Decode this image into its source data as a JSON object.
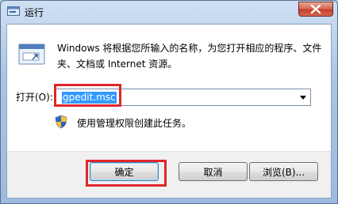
{
  "window": {
    "title": "运行"
  },
  "dialog": {
    "description": "Windows 将根据您所输入的名称，为您打开相应的程序、文件夹、文档或 Internet 资源。",
    "open_label": "打开(O):",
    "input_value": "gpedit.msc",
    "admin_note": "使用管理权限创建此任务。"
  },
  "buttons": {
    "ok": "确定",
    "cancel": "取消",
    "browse": "浏览(B)..."
  },
  "icons": [
    "run-program-icon",
    "close-icon",
    "dropdown-arrow-icon",
    "uac-shield-icon"
  ],
  "colors": {
    "highlight_box": "#e0262c",
    "selection": "#3399ff"
  }
}
